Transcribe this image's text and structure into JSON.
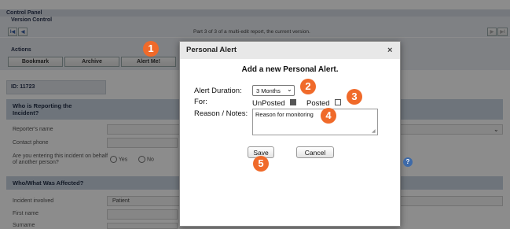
{
  "page": {
    "control_panel": "Control Panel",
    "version_control": "Version Control",
    "nav_first": "I◀",
    "nav_prev": "◀",
    "nav_next": "▶",
    "nav_last": "▶I",
    "report_info": "Part 3 of 3 of a multi-edit report, the current version.",
    "actions_label": "Actions",
    "buttons": {
      "bookmark": "Bookmark",
      "archive": "Archive",
      "alert_me": "Alert Me!"
    },
    "id_label": "ID: 11723"
  },
  "sections": {
    "reporting": "Who is Reporting the Incident?",
    "affected": "Who/What Was Affected?"
  },
  "fields": {
    "reporter_name": "Reporter's name",
    "contact_phone": "Contact phone",
    "on_behalf": "Are you entering this incident on behalf of another person?",
    "yes": "Yes",
    "no": "No",
    "incident_involved": "Incident involved",
    "incident_involved_value": "Patient",
    "first_name": "First name",
    "surname": "Surname"
  },
  "dialog": {
    "title": "Personal Alert",
    "close": "×",
    "heading": "Add a new Personal Alert.",
    "duration_label": "Alert Duration:",
    "duration_value": "3 Months",
    "for_label": "For:",
    "unposted_label": "UnPosted",
    "posted_label": "Posted",
    "unposted_checked": true,
    "posted_checked": false,
    "reason_label": "Reason / Notes:",
    "reason_value": "Reason for monitoring",
    "save": "Save",
    "cancel": "Cancel"
  },
  "badges": [
    "1",
    "2",
    "3",
    "4",
    "5"
  ],
  "colors": {
    "badge": "#f06a2a",
    "header": "#d6dbe4",
    "section": "#c9d3e0"
  }
}
